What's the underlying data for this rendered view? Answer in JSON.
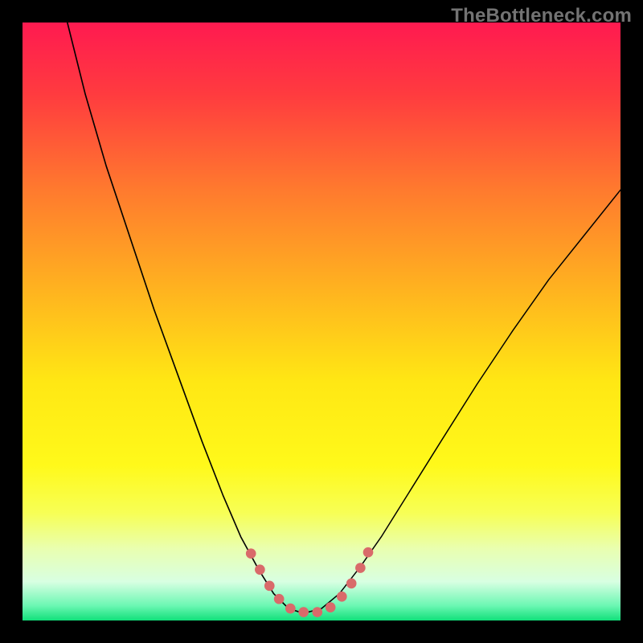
{
  "watermark": {
    "text": "TheBottleneck.com"
  },
  "chart_data": {
    "type": "line",
    "title": "",
    "xlabel": "",
    "ylabel": "",
    "xlim": [
      0,
      1000
    ],
    "ylim": [
      0,
      1000
    ],
    "grid": false,
    "legend": false,
    "background": {
      "stops": [
        {
          "offset": 0.0,
          "color": "#ff1a50"
        },
        {
          "offset": 0.12,
          "color": "#ff3b3f"
        },
        {
          "offset": 0.28,
          "color": "#ff7a2e"
        },
        {
          "offset": 0.45,
          "color": "#ffb41f"
        },
        {
          "offset": 0.6,
          "color": "#ffe714"
        },
        {
          "offset": 0.74,
          "color": "#fff91a"
        },
        {
          "offset": 0.82,
          "color": "#f7ff55"
        },
        {
          "offset": 0.88,
          "color": "#e9ffb0"
        },
        {
          "offset": 0.935,
          "color": "#d8ffe2"
        },
        {
          "offset": 0.975,
          "color": "#6cf7b3"
        },
        {
          "offset": 1.0,
          "color": "#11e07a"
        }
      ]
    },
    "series": [
      {
        "name": "curve-left",
        "color": "#000000",
        "width": 2.2,
        "points": [
          {
            "x": 75,
            "y": 1000
          },
          {
            "x": 105,
            "y": 880
          },
          {
            "x": 140,
            "y": 760
          },
          {
            "x": 180,
            "y": 640
          },
          {
            "x": 220,
            "y": 520
          },
          {
            "x": 260,
            "y": 410
          },
          {
            "x": 300,
            "y": 300
          },
          {
            "x": 335,
            "y": 210
          },
          {
            "x": 365,
            "y": 140
          },
          {
            "x": 395,
            "y": 85
          },
          {
            "x": 420,
            "y": 45
          },
          {
            "x": 445,
            "y": 20
          },
          {
            "x": 470,
            "y": 12
          }
        ]
      },
      {
        "name": "curve-right",
        "color": "#000000",
        "width": 2.0,
        "points": [
          {
            "x": 470,
            "y": 12
          },
          {
            "x": 500,
            "y": 20
          },
          {
            "x": 530,
            "y": 45
          },
          {
            "x": 565,
            "y": 90
          },
          {
            "x": 600,
            "y": 140
          },
          {
            "x": 650,
            "y": 220
          },
          {
            "x": 700,
            "y": 300
          },
          {
            "x": 760,
            "y": 395
          },
          {
            "x": 820,
            "y": 485
          },
          {
            "x": 880,
            "y": 570
          },
          {
            "x": 940,
            "y": 645
          },
          {
            "x": 1000,
            "y": 720
          }
        ]
      },
      {
        "name": "dotted-bottom",
        "color": "#d96a6a",
        "style": "dotted",
        "dot_radius": 8.5,
        "points": [
          {
            "x": 382,
            "y": 112
          },
          {
            "x": 397,
            "y": 85
          },
          {
            "x": 413,
            "y": 58
          },
          {
            "x": 429,
            "y": 36
          },
          {
            "x": 448,
            "y": 20
          },
          {
            "x": 470,
            "y": 14
          },
          {
            "x": 493,
            "y": 14
          },
          {
            "x": 515,
            "y": 22
          },
          {
            "x": 534,
            "y": 40
          },
          {
            "x": 550,
            "y": 62
          },
          {
            "x": 565,
            "y": 88
          },
          {
            "x": 578,
            "y": 114
          }
        ]
      }
    ]
  }
}
